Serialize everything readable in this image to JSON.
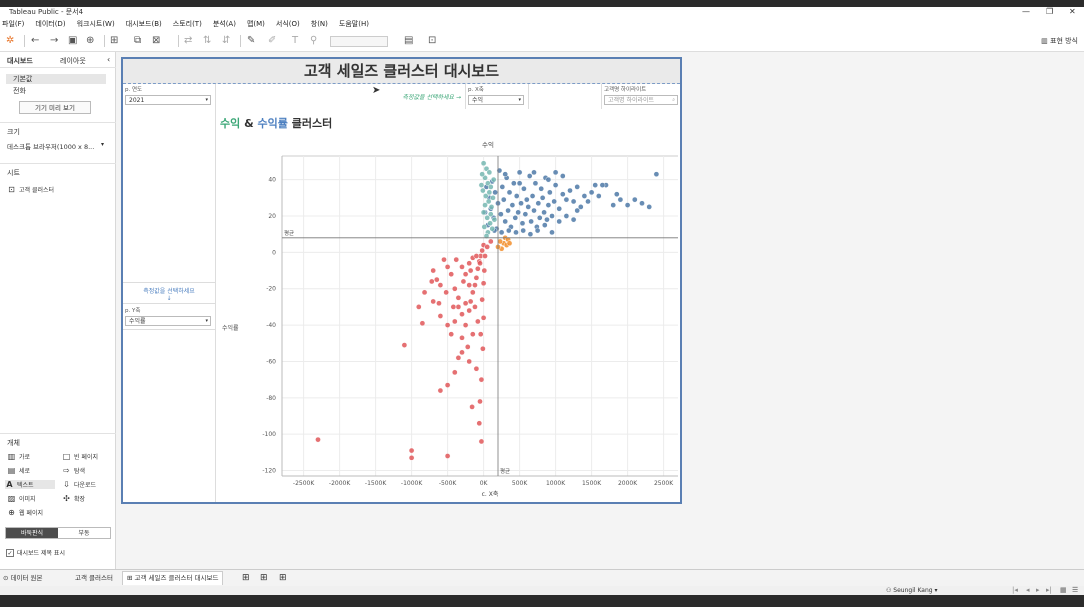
{
  "window": {
    "title": "Tableau Public - 문서4",
    "controls": [
      "—",
      "❐",
      "✕"
    ]
  },
  "menu": [
    "파일(F)",
    "데이터(D)",
    "워크시트(W)",
    "대시보드(B)",
    "스토리(T)",
    "분석(A)",
    "맵(M)",
    "서식(O)",
    "창(N)",
    "도움말(H)"
  ],
  "toolbar": {
    "show_me": "표현 방식"
  },
  "side_panel": {
    "tabs": [
      "대시보드",
      "레이아웃"
    ],
    "device_default": "기본값",
    "device_phone": "전화",
    "device_preview_button": "기기 미리 보기",
    "size_header": "크기",
    "size_value": "데스크톱 브라우저(1000 x 8...",
    "sheets_header": "시트",
    "sheet_item": "고객 클러스터",
    "objects_header": "개체",
    "objects": [
      {
        "label": "가로",
        "icon": "horizontal-icon"
      },
      {
        "label": "빈 페이지",
        "icon": "blank-icon"
      },
      {
        "label": "세로",
        "icon": "vertical-icon"
      },
      {
        "label": "탐색",
        "icon": "navigation-icon"
      },
      {
        "label": "텍스트",
        "icon": "text-icon"
      },
      {
        "label": "다운로드",
        "icon": "download-icon"
      },
      {
        "label": "이미지",
        "icon": "image-icon"
      },
      {
        "label": "확장",
        "icon": "extension-icon"
      },
      {
        "label": "웹 페이지",
        "icon": "web-icon"
      }
    ],
    "tiled": "바둑판식",
    "floating": "부동",
    "show_title_label": "대시보드 제목 표시"
  },
  "dashboard": {
    "title": "고객 세일즈 클러스터 대시보드",
    "filters": {
      "year_label": "p. 연도",
      "year_value": "2021",
      "prompt_text": "측정값을 선택하세요 →",
      "x_label": "p. X축",
      "x_value": "수익",
      "highlight_label": "고객명 하이라이트",
      "highlight_placeholder": "고객명 하이라이트"
    },
    "left": {
      "prompt_text": "측정값을 선택하세요",
      "arrow": "↓",
      "y_label": "p. Y축",
      "y_value": "수익률"
    }
  },
  "chart_data": {
    "type": "scatter",
    "title_parts": [
      "수익",
      " & ",
      "수익률",
      " 클러스터"
    ],
    "title_colors": [
      "#3aa676",
      "#333333",
      "#4c7fc0",
      "#333333"
    ],
    "x_header": "수익",
    "xlabel": "c. X축",
    "ylabel": "수익률",
    "xlim": [
      -2800,
      2700
    ],
    "ylim": [
      -123,
      53
    ],
    "x_ticks": [
      -2500,
      -2000,
      -1500,
      -1000,
      -500,
      0,
      500,
      1000,
      1500,
      2000,
      2500
    ],
    "x_tick_labels": [
      "-2500K",
      "-2000K",
      "-1500K",
      "-1000K",
      "-500K",
      "0K",
      "500K",
      "1000K",
      "1500K",
      "2000K",
      "2500K"
    ],
    "y_ticks": [
      40,
      20,
      0,
      -20,
      -40,
      -60,
      -80,
      -100,
      -120
    ],
    "avg_x": 200,
    "avg_y": 8,
    "avg_label": "평균",
    "grid": true,
    "cluster_colors": {
      "high_profit": "#4e79a7",
      "high_margin": "#76b7b2",
      "loss": "#e15759",
      "small": "#f28e2b"
    },
    "series": [
      {
        "cluster": "high_profit",
        "points": [
          [
            2400,
            43
          ],
          [
            2300,
            25
          ],
          [
            2200,
            27
          ],
          [
            2100,
            29
          ],
          [
            2000,
            26
          ],
          [
            1900,
            29
          ],
          [
            1850,
            32
          ],
          [
            1800,
            26
          ],
          [
            1700,
            37
          ],
          [
            1650,
            37
          ],
          [
            1600,
            31
          ],
          [
            1550,
            37
          ],
          [
            1500,
            33
          ],
          [
            1450,
            28
          ],
          [
            1400,
            31
          ],
          [
            1350,
            25
          ],
          [
            1300,
            23
          ],
          [
            1250,
            28
          ],
          [
            1200,
            34
          ],
          [
            1150,
            29
          ],
          [
            1100,
            32
          ],
          [
            1050,
            24
          ],
          [
            1000,
            37
          ],
          [
            980,
            28
          ],
          [
            950,
            20
          ],
          [
            920,
            33
          ],
          [
            900,
            26
          ],
          [
            880,
            18
          ],
          [
            860,
            41
          ],
          [
            840,
            22
          ],
          [
            820,
            30
          ],
          [
            800,
            35
          ],
          [
            780,
            19
          ],
          [
            760,
            27
          ],
          [
            740,
            14
          ],
          [
            720,
            38
          ],
          [
            700,
            23
          ],
          [
            680,
            31
          ],
          [
            660,
            17
          ],
          [
            640,
            42
          ],
          [
            620,
            25
          ],
          [
            600,
            29
          ],
          [
            580,
            21
          ],
          [
            560,
            35
          ],
          [
            540,
            16
          ],
          [
            520,
            27
          ],
          [
            500,
            44
          ],
          [
            480,
            22
          ],
          [
            460,
            31
          ],
          [
            440,
            19
          ],
          [
            420,
            38
          ],
          [
            400,
            26
          ],
          [
            380,
            14
          ],
          [
            360,
            33
          ],
          [
            340,
            23
          ],
          [
            320,
            41
          ],
          [
            300,
            17
          ],
          [
            280,
            29
          ],
          [
            260,
            36
          ],
          [
            240,
            21
          ],
          [
            220,
            45
          ],
          [
            200,
            27
          ],
          [
            180,
            13
          ],
          [
            160,
            33
          ],
          [
            140,
            19
          ],
          [
            120,
            39
          ],
          [
            100,
            24
          ],
          [
            80,
            30
          ],
          [
            60,
            15
          ],
          [
            40,
            36
          ],
          [
            20,
            22
          ],
          [
            650,
            10
          ],
          [
            750,
            12
          ],
          [
            850,
            15
          ],
          [
            950,
            11
          ],
          [
            1050,
            17
          ],
          [
            550,
            12
          ],
          [
            450,
            11
          ],
          [
            350,
            12
          ],
          [
            250,
            11
          ],
          [
            150,
            12
          ],
          [
            1150,
            20
          ],
          [
            1250,
            18
          ],
          [
            900,
            40
          ],
          [
            700,
            44
          ],
          [
            500,
            38
          ],
          [
            300,
            43
          ],
          [
            1100,
            42
          ],
          [
            1300,
            36
          ],
          [
            1000,
            44
          ]
        ]
      },
      {
        "cluster": "high_margin",
        "points": [
          [
            0,
            49
          ],
          [
            40,
            46
          ],
          [
            80,
            44
          ],
          [
            20,
            41
          ],
          [
            60,
            38
          ],
          [
            100,
            36
          ],
          [
            -10,
            34
          ],
          [
            30,
            31
          ],
          [
            70,
            28
          ],
          [
            110,
            25
          ],
          [
            0,
            22
          ],
          [
            50,
            19
          ],
          [
            90,
            16
          ],
          [
            10,
            14
          ],
          [
            60,
            11
          ],
          [
            120,
            13
          ],
          [
            -20,
            43
          ],
          [
            140,
            40
          ],
          [
            130,
            30
          ],
          [
            20,
            26
          ],
          [
            100,
            21
          ],
          [
            40,
            9
          ],
          [
            80,
            33
          ],
          [
            -30,
            37
          ],
          [
            150,
            18
          ]
        ]
      },
      {
        "cluster": "small",
        "points": [
          [
            250,
            2
          ],
          [
            280,
            5
          ],
          [
            300,
            8
          ],
          [
            320,
            4
          ],
          [
            340,
            7
          ],
          [
            200,
            3
          ],
          [
            360,
            5
          ],
          [
            230,
            6
          ]
        ]
      },
      {
        "cluster": "loss",
        "points": [
          [
            -2300,
            -103
          ],
          [
            -1000,
            -109
          ],
          [
            -1000,
            -113
          ],
          [
            -500,
            -112
          ],
          [
            -1100,
            -51
          ],
          [
            -850,
            -39
          ],
          [
            -900,
            -30
          ],
          [
            -700,
            -27
          ],
          [
            -600,
            -76
          ],
          [
            -500,
            -73
          ],
          [
            -400,
            -66
          ],
          [
            -350,
            -58
          ],
          [
            -300,
            -47
          ],
          [
            -250,
            -40
          ],
          [
            -200,
            -32
          ],
          [
            -180,
            -27
          ],
          [
            -150,
            -22
          ],
          [
            -120,
            -18
          ],
          [
            -100,
            -14
          ],
          [
            -80,
            -9
          ],
          [
            -60,
            -5
          ],
          [
            -40,
            -2
          ],
          [
            -20,
            1
          ],
          [
            0,
            4
          ],
          [
            -700,
            -10
          ],
          [
            -650,
            -15
          ],
          [
            -600,
            -18
          ],
          [
            -550,
            -4
          ],
          [
            -500,
            -8
          ],
          [
            -450,
            -12
          ],
          [
            -400,
            -20
          ],
          [
            -350,
            -25
          ],
          [
            -300,
            -8
          ],
          [
            -250,
            -12
          ],
          [
            -200,
            -6
          ],
          [
            -150,
            -3
          ],
          [
            -100,
            -2
          ],
          [
            -50,
            -6
          ],
          [
            -600,
            -35
          ],
          [
            -500,
            -40
          ],
          [
            -450,
            -45
          ],
          [
            -400,
            -38
          ],
          [
            -350,
            -30
          ],
          [
            -300,
            -34
          ],
          [
            -250,
            -28
          ],
          [
            -200,
            -18
          ],
          [
            -120,
            -30
          ],
          [
            -80,
            -38
          ],
          [
            -40,
            -45
          ],
          [
            -20,
            -26
          ],
          [
            0,
            -17
          ],
          [
            10,
            -10
          ],
          [
            20,
            -2
          ],
          [
            50,
            3
          ],
          [
            100,
            6
          ],
          [
            -300,
            -55
          ],
          [
            -200,
            -60
          ],
          [
            -100,
            -64
          ],
          [
            -50,
            -82
          ],
          [
            -30,
            -70
          ],
          [
            -10,
            -53
          ],
          [
            0,
            -36
          ],
          [
            -150,
            -45
          ],
          [
            -420,
            -30
          ],
          [
            -520,
            -22
          ],
          [
            -620,
            -28
          ],
          [
            -720,
            -16
          ],
          [
            -820,
            -22
          ],
          [
            -220,
            -52
          ],
          [
            -160,
            -85
          ],
          [
            -60,
            -94
          ],
          [
            -30,
            -104
          ],
          [
            -380,
            -4
          ],
          [
            -280,
            -16
          ],
          [
            -180,
            -10
          ]
        ]
      }
    ]
  },
  "bottom": {
    "tabs": [
      "데이터 원본",
      "고객 클러스터",
      "고객 세일즈 클러스터 대시보드"
    ],
    "user": "Seungil Kang"
  }
}
